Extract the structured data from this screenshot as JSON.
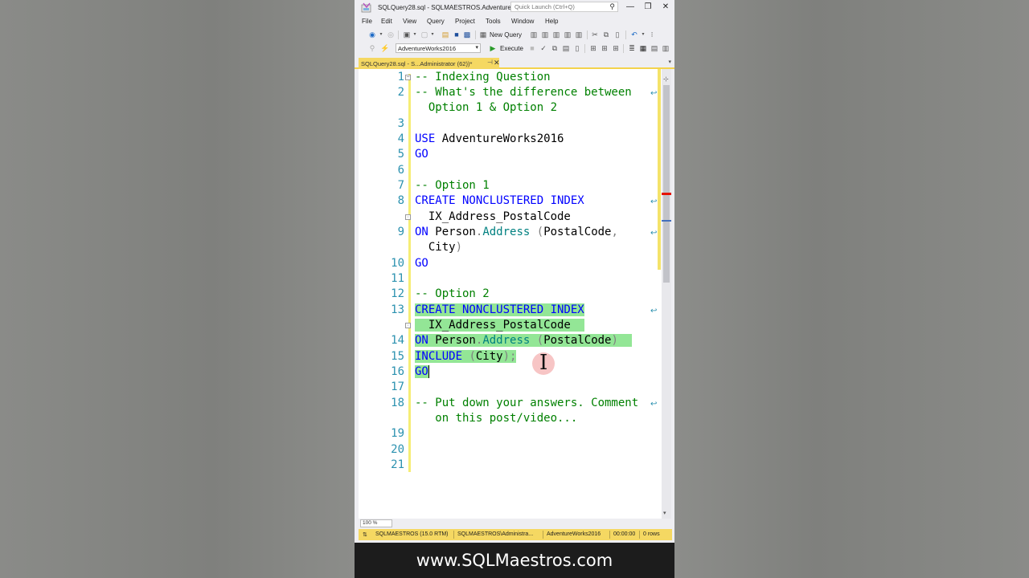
{
  "window": {
    "title": "SQLQuery28.sql - SQLMAESTROS.Adventure...",
    "quick_launch_placeholder": "Quick Launch (Ctrl+Q)",
    "minimize": "—",
    "restore": "❐",
    "close": "✕"
  },
  "menu": [
    "File",
    "Edit",
    "View",
    "Query",
    "Project",
    "Tools",
    "Window",
    "Help"
  ],
  "toolbar": {
    "new_query": "New Query",
    "database": "AdventureWorks2016",
    "execute": "Execute"
  },
  "tab": {
    "title": "SQLQuery28.sql - S...Administrator (62))*",
    "pin": "⊣",
    "close": "✕"
  },
  "editor": {
    "line_numbers": [
      "1",
      "2",
      "3",
      "4",
      "5",
      "6",
      "7",
      "8",
      "9",
      "10",
      "11",
      "12",
      "13",
      "14",
      "15",
      "16",
      "17",
      "18",
      "19",
      "20",
      "21"
    ],
    "lines": {
      "l1": "-- Indexing Question",
      "l2a": "-- What's the difference between",
      "l2b": "  Option 1 & Option 2",
      "l4_kw": "USE",
      "l4_rest": " AdventureWorks2016",
      "l5": "GO",
      "l7": "-- Option 1",
      "l8a": "CREATE NONCLUSTERED INDEX",
      "l8b": "  IX_Address_PostalCode",
      "l9_on": "ON",
      "l9_person": " Person",
      "l9_dot": ".",
      "l9_address": "Address",
      "l9_paren": " (",
      "l9_col": "PostalCode",
      "l9_comma": ",",
      "l9b_city": "  City",
      "l9b_paren": ")",
      "l10": "GO",
      "l12": "-- Option 2",
      "l13a": "CREATE NONCLUSTERED INDEX",
      "l13b": "  IX_Address_PostalCode",
      "l14_on": "ON",
      "l14_person": " Person",
      "l14_dot": ".",
      "l14_address": "Address",
      "l14_open": " (",
      "l14_col": "PostalCode",
      "l14_close": ")",
      "l15_kw": "INCLUDE",
      "l15_open": " (",
      "l15_col": "City",
      "l15_close": ");",
      "l16": "GO",
      "l18a": "-- Put down your answers. Comment",
      "l18b": "   on this post/video..."
    }
  },
  "zoom": "100 %",
  "status": {
    "server": "SQLMAESTROS (15.0 RTM)",
    "user": "SQLMAESTROS\\Administra...",
    "database": "AdventureWorks2016",
    "time": "00:00:00",
    "rows": "0 rows"
  },
  "banner": "www.SQLMaestros.com",
  "colors": {
    "keyword": "#0000ff",
    "comment": "#008000",
    "highlight": "#93e696",
    "status_bar": "#f5d862",
    "line_number": "#2b91af"
  }
}
